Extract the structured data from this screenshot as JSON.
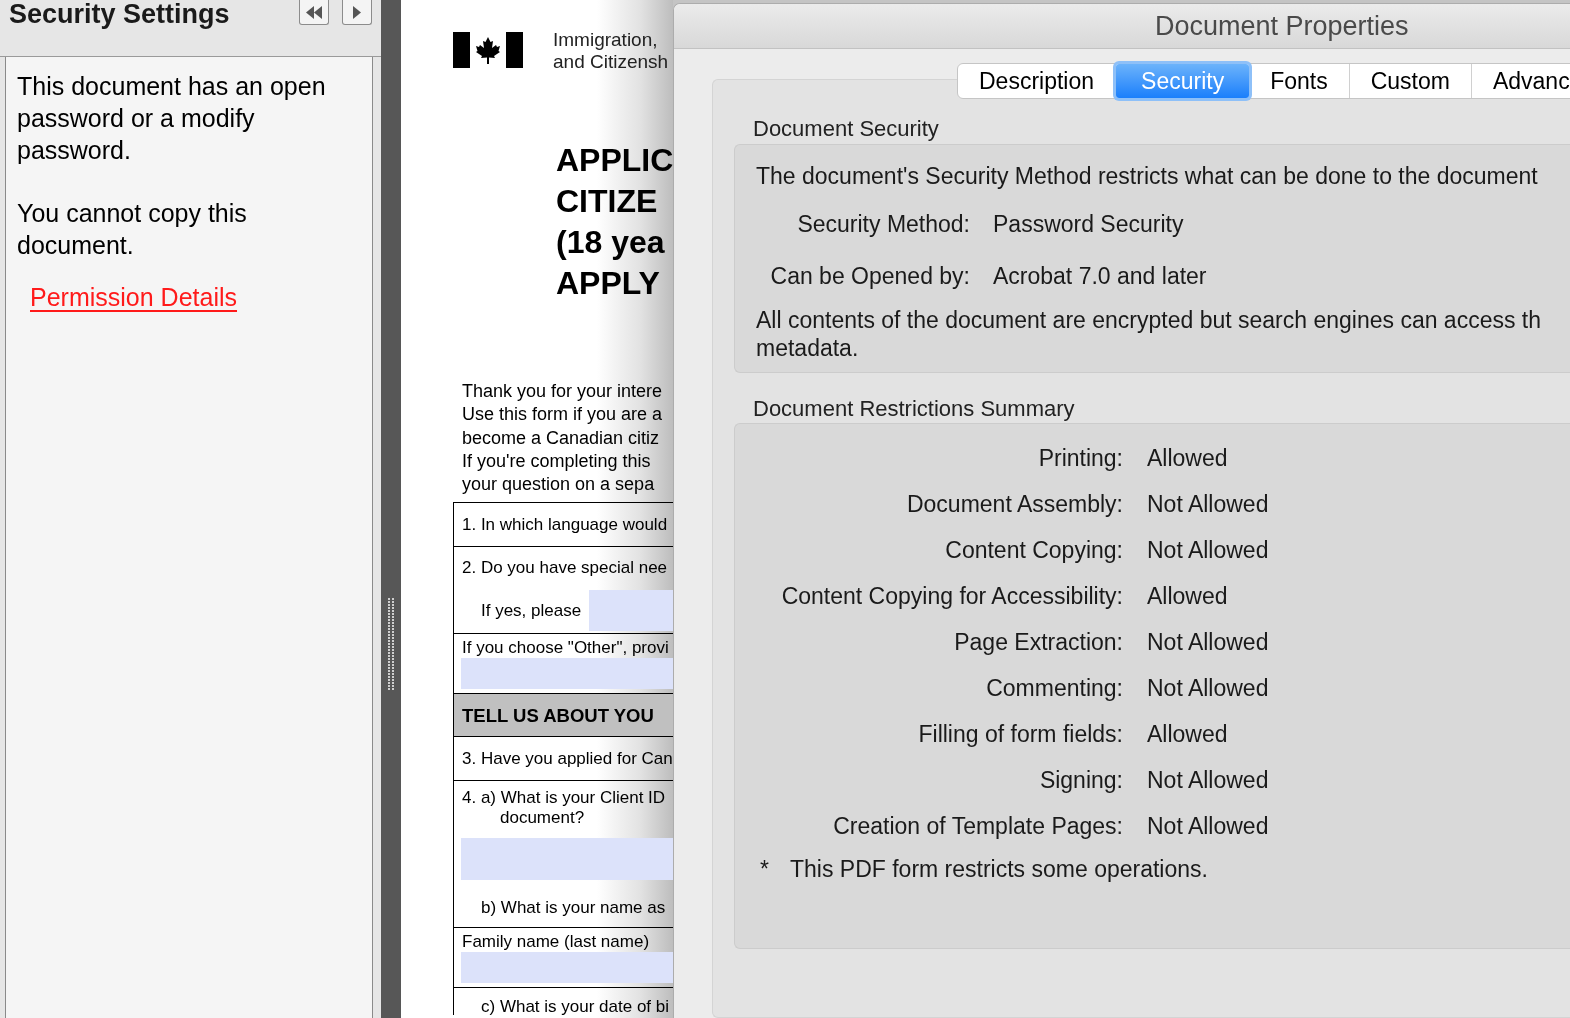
{
  "sidebar": {
    "title": "Security Settings",
    "paragraphs": [
      "This document has an open password or a modify password.",
      "You cannot copy this document."
    ],
    "link": "Permission Details"
  },
  "document_page": {
    "agency_lines": [
      "Immigration,",
      "and Citizensh"
    ],
    "title_lines": [
      "APPLIC",
      "CITIZE",
      "(18 yea",
      "APPLY"
    ],
    "intro_lines": [
      "Thank you for your intere",
      "Use this form if you are a",
      "become a Canadian citiz",
      "If you're completing this",
      "your question on a sepa"
    ],
    "form_rows": [
      {
        "kind": "question",
        "text": "1. In which language would"
      },
      {
        "kind": "question_with_field",
        "text": "2. Do you have special nee",
        "field_label": "If yes, please"
      },
      {
        "kind": "field_below",
        "text": "If you choose \"Other\", provi"
      },
      {
        "kind": "section",
        "text": "TELL US ABOUT YOU"
      },
      {
        "kind": "question",
        "text": "3. Have you applied for Can"
      },
      {
        "kind": "two_part",
        "lines": [
          "4. a) What is your Client ID",
          "document?"
        ],
        "subquestion": "b) What is your name as"
      },
      {
        "kind": "field_below",
        "text": "Family name (last name)"
      },
      {
        "kind": "subquestion",
        "text": "c) What is your date of bi"
      }
    ]
  },
  "dialog": {
    "title": "Document Properties",
    "tabs": [
      {
        "label": "Description",
        "selected": false
      },
      {
        "label": "Security",
        "selected": true
      },
      {
        "label": "Fonts",
        "selected": false
      },
      {
        "label": "Custom",
        "selected": false
      },
      {
        "label": "Advanc",
        "selected": false
      }
    ],
    "document_security": {
      "heading": "Document Security",
      "description": "The document's Security Method restricts what can be done to the document",
      "fields": [
        {
          "label": "Security Method:",
          "value": "Password Security"
        },
        {
          "label": "Can be Opened by:",
          "value": "Acrobat 7.0 and later"
        }
      ],
      "note_lines": [
        "All contents of the document are encrypted but search engines can access th",
        "metadata."
      ]
    },
    "restrictions": {
      "heading": "Document Restrictions Summary",
      "items": [
        {
          "label": "Printing:",
          "value": "Allowed"
        },
        {
          "label": "Document Assembly:",
          "value": "Not Allowed"
        },
        {
          "label": "Content Copying:",
          "value": "Not Allowed"
        },
        {
          "label": "Content Copying for Accessibility:",
          "value": "Allowed"
        },
        {
          "label": "Page Extraction:",
          "value": "Not Allowed"
        },
        {
          "label": "Commenting:",
          "value": "Not Allowed"
        },
        {
          "label": "Filling of form fields:",
          "value": "Allowed"
        },
        {
          "label": "Signing:",
          "value": "Not Allowed"
        },
        {
          "label": "Creation of Template Pages:",
          "value": "Not Allowed"
        }
      ],
      "footnote_mark": "*",
      "footnote": "This PDF form restricts some operations."
    }
  }
}
